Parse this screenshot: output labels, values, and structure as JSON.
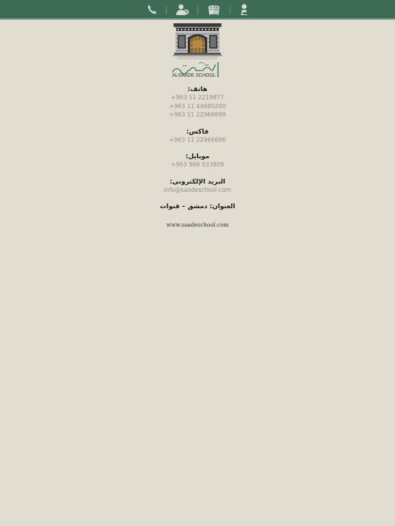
{
  "nav": {
    "icons": [
      "phone-icon",
      "contacts-icon",
      "book-icon",
      "person-icon"
    ]
  },
  "logo": {
    "arabic_text": "ثانوية السعادة",
    "latin_text": "ALSAADE SCHOOL"
  },
  "contact": {
    "phone_label": "هاتف:",
    "phones": [
      "+963 11 2219877",
      "+963 11 44680200",
      "+963 11 22966699"
    ],
    "fax_label": "فاكس:",
    "fax": "+963 11 22966696",
    "mobile_label": "موبايل:",
    "mobile": "+963 966 033809",
    "email_label": "البريد الإلكتروني:",
    "email": "info@saadeschool.com",
    "address_label": "العنوان: دمشق – قنوات",
    "website": "www.saadeschool.com"
  },
  "colors": {
    "topbar": "#3e6b55",
    "background": "#e2ddd1",
    "icon": "#d7ddd6"
  }
}
